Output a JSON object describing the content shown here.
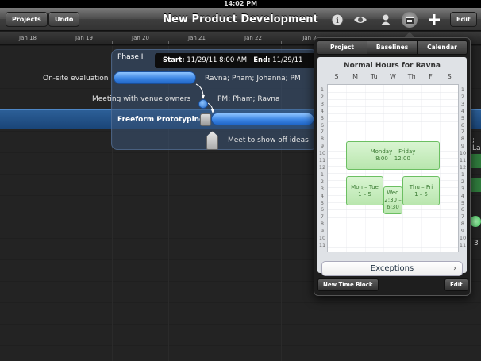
{
  "status_bar": {
    "time": "14:02 PM"
  },
  "toolbar": {
    "projects_label": "Projects",
    "undo_label": "Undo",
    "title": "New Product Development",
    "edit_label": "Edit",
    "icons": [
      "info-icon",
      "eye-icon",
      "person-icon",
      "calendar-icon",
      "plus-icon"
    ]
  },
  "timeline": {
    "dates": [
      "Jan 18",
      "Jan 19",
      "Jan 20",
      "Jan 21",
      "Jan 22",
      "Jan 2"
    ]
  },
  "gantt": {
    "phase_label": "Phase I",
    "tooltip": {
      "start_label": "Start:",
      "start_value": "11/29/11 8:00 AM",
      "end_label": "End:",
      "end_value": "11/29/11"
    },
    "tasks": [
      {
        "name": "On-site evaluation",
        "resources": "Ravna; Pham; Johanna; PM"
      },
      {
        "name": "Meeting with venue owners",
        "resources": "PM; Pham; Ravna"
      },
      {
        "name": "Freeform Prototyping",
        "resources": ""
      },
      {
        "name": "Meet to show off ideas",
        "resources": ""
      }
    ],
    "edge_text_1": "; La",
    "edge_text_2": "3"
  },
  "popover": {
    "tabs": [
      "Project",
      "Baselines",
      "Calendar"
    ],
    "active_tab": "Baselines",
    "title": "Normal Hours for Ravna",
    "days": [
      "S",
      "M",
      "Tu",
      "W",
      "Th",
      "F",
      "S"
    ],
    "hours": [
      "1",
      "2",
      "3",
      "4",
      "5",
      "6",
      "7",
      "8",
      "9",
      "10",
      "11",
      "12",
      "1",
      "2",
      "3",
      "4",
      "5",
      "6",
      "7",
      "8",
      "9",
      "10",
      "11"
    ],
    "blocks": [
      {
        "line1": "Monday – Friday",
        "line2": "8:00 – 12:00"
      },
      {
        "line1": "Mon – Tue",
        "line2": "1 – 5"
      },
      {
        "line1": "Wed",
        "line2": "2:30 – 6:30"
      },
      {
        "line1": "Thu – Fri",
        "line2": "1 – 5"
      }
    ],
    "exceptions_label": "Exceptions",
    "new_time_block_label": "New Time Block",
    "edit_label": "Edit"
  },
  "colors": {
    "bar_blue": "#3d86e4",
    "selected_row": "#1a4578",
    "block_green": "#b9e6ae"
  }
}
